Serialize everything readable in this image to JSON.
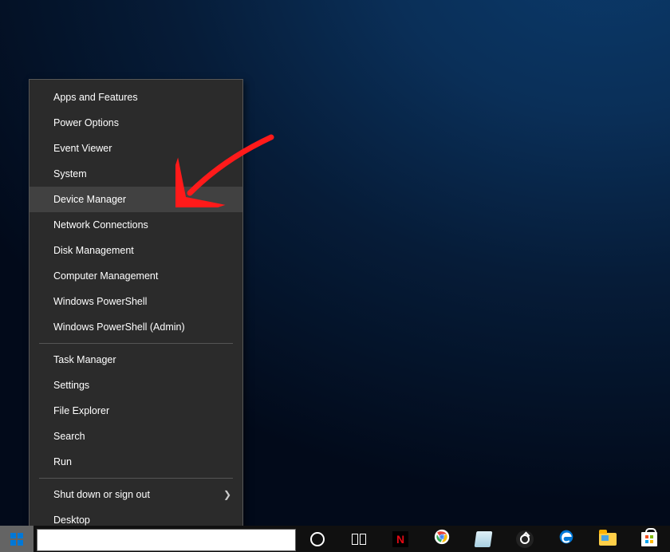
{
  "menu": {
    "groups": [
      [
        {
          "id": "apps-features",
          "label": "Apps and Features",
          "hovered": false,
          "submenu": false
        },
        {
          "id": "power-options",
          "label": "Power Options",
          "hovered": false,
          "submenu": false
        },
        {
          "id": "event-viewer",
          "label": "Event Viewer",
          "hovered": false,
          "submenu": false
        },
        {
          "id": "system",
          "label": "System",
          "hovered": false,
          "submenu": false
        },
        {
          "id": "device-manager",
          "label": "Device Manager",
          "hovered": true,
          "submenu": false
        },
        {
          "id": "network-conn",
          "label": "Network Connections",
          "hovered": false,
          "submenu": false
        },
        {
          "id": "disk-mgmt",
          "label": "Disk Management",
          "hovered": false,
          "submenu": false
        },
        {
          "id": "computer-mgmt",
          "label": "Computer Management",
          "hovered": false,
          "submenu": false
        },
        {
          "id": "powershell",
          "label": "Windows PowerShell",
          "hovered": false,
          "submenu": false
        },
        {
          "id": "powershell-admin",
          "label": "Windows PowerShell (Admin)",
          "hovered": false,
          "submenu": false
        }
      ],
      [
        {
          "id": "task-manager",
          "label": "Task Manager",
          "hovered": false,
          "submenu": false
        },
        {
          "id": "settings",
          "label": "Settings",
          "hovered": false,
          "submenu": false
        },
        {
          "id": "file-explorer",
          "label": "File Explorer",
          "hovered": false,
          "submenu": false
        },
        {
          "id": "search",
          "label": "Search",
          "hovered": false,
          "submenu": false
        },
        {
          "id": "run",
          "label": "Run",
          "hovered": false,
          "submenu": false
        }
      ],
      [
        {
          "id": "shutdown",
          "label": "Shut down or sign out",
          "hovered": false,
          "submenu": true
        },
        {
          "id": "desktop",
          "label": "Desktop",
          "hovered": false,
          "submenu": false
        }
      ]
    ]
  },
  "taskbar": {
    "search_placeholder": "",
    "icons": [
      {
        "id": "cortana",
        "name": "cortana-icon"
      },
      {
        "id": "taskview",
        "name": "task-view-icon"
      },
      {
        "id": "netflix",
        "name": "netflix-icon",
        "glyph": "N"
      },
      {
        "id": "chrome",
        "name": "chrome-icon"
      },
      {
        "id": "sticky-notes",
        "name": "sticky-notes-icon"
      },
      {
        "id": "photos",
        "name": "photos-icon"
      },
      {
        "id": "edge",
        "name": "edge-icon"
      },
      {
        "id": "file-explorer",
        "name": "file-explorer-icon"
      },
      {
        "id": "store",
        "name": "microsoft-store-icon"
      }
    ]
  },
  "annotation": {
    "target": "device-manager"
  }
}
